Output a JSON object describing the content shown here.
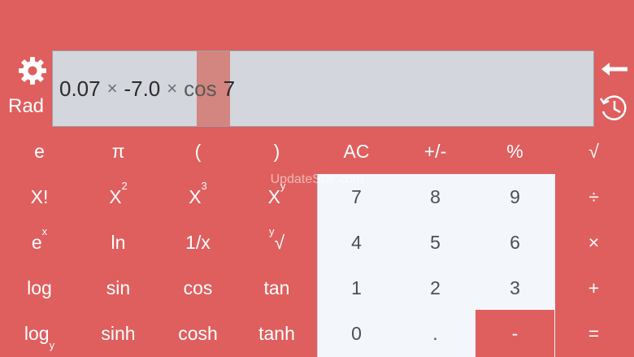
{
  "settings_icon": "gear-icon",
  "mode_label": "Rad",
  "expression": {
    "tokens": [
      "0.07",
      "×",
      "-7.0",
      "×",
      "cos",
      "7"
    ]
  },
  "back_icon": "arrow-left-icon",
  "history_icon": "history-clock-icon",
  "watermark": "UpdateStar.com",
  "keys": {
    "e": "e",
    "pi": "π",
    "lparen": "(",
    "rparen": ")",
    "ac": "AC",
    "sign": "+/-",
    "percent": "%",
    "sqrt": "√",
    "factorial": "X!",
    "square_base": "X",
    "square_exp": "2",
    "cube_base": "X",
    "cube_exp": "3",
    "pow_base": "X",
    "pow_exp": "y",
    "divide": "÷",
    "exp_base": "e",
    "exp_exp": "x",
    "ln": "ln",
    "reciprocal": "1/x",
    "root_idx": "y",
    "root_sym": "√",
    "multiply": "×",
    "log": "log",
    "sin": "sin",
    "cos": "cos",
    "tan": "tan",
    "plus": "+",
    "logy_base": "log",
    "logy_sub": "y",
    "sinh": "sinh",
    "cosh": "cosh",
    "tanh": "tanh",
    "minus": "-",
    "equals": "=",
    "d7": "7",
    "d8": "8",
    "d9": "9",
    "d4": "4",
    "d5": "5",
    "d6": "6",
    "d1": "1",
    "d2": "2",
    "d3": "3",
    "d0": "0",
    "dot": "."
  }
}
